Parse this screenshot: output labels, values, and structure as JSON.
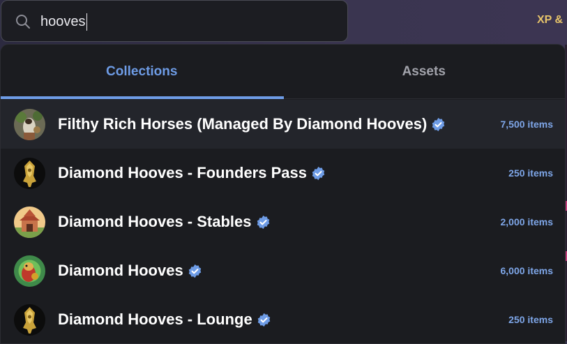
{
  "search": {
    "value": "hooves"
  },
  "header": {
    "xp_label": "XP &"
  },
  "tabs": [
    {
      "label": "Collections",
      "active": true
    },
    {
      "label": "Assets",
      "active": false
    }
  ],
  "results": [
    {
      "name": "Filthy Rich Horses (Managed By Diamond Hooves)",
      "count": "7,500 items",
      "verified": true,
      "avatar": "horses-avatar"
    },
    {
      "name": "Diamond Hooves - Founders Pass",
      "count": "250 items",
      "verified": true,
      "avatar": "golden-statue-avatar"
    },
    {
      "name": "Diamond Hooves - Stables",
      "count": "2,000 items",
      "verified": true,
      "avatar": "stable-building-avatar"
    },
    {
      "name": "Diamond Hooves",
      "count": "6,000 items",
      "verified": true,
      "avatar": "horse-character-avatar"
    },
    {
      "name": "Diamond Hooves - Lounge",
      "count": "250 items",
      "verified": true,
      "avatar": "golden-statue-avatar"
    }
  ],
  "colors": {
    "accent": "#6e9ce6",
    "count_text": "#7ea6e8",
    "dropdown_bg": "#1b1c20",
    "xp_gold": "#e6c36a"
  }
}
